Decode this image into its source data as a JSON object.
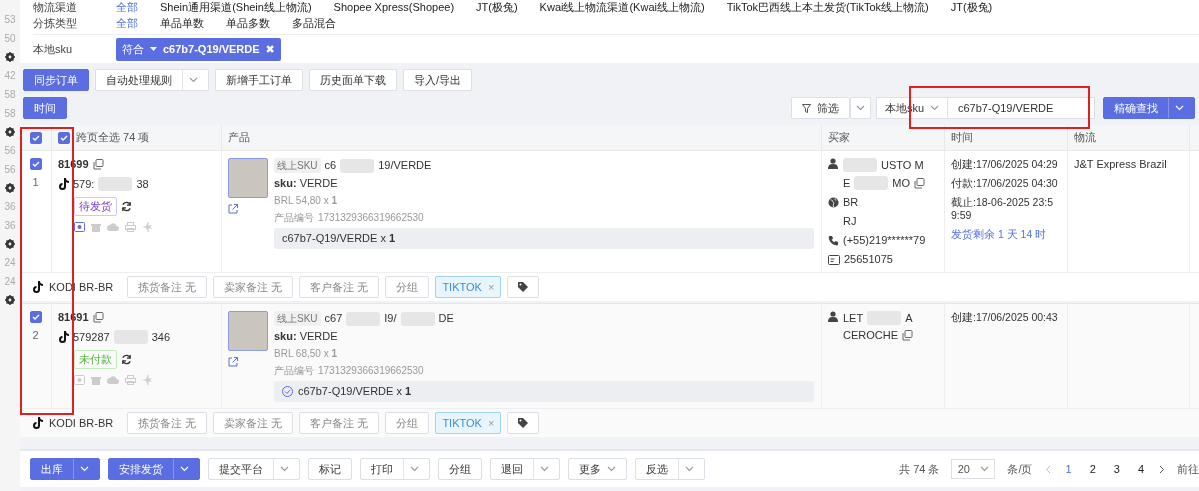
{
  "gutter": [
    {
      "kind": "number",
      "text": "53"
    },
    {
      "kind": "number",
      "text": "50"
    },
    {
      "kind": "gear"
    },
    {
      "kind": "number",
      "text": "42"
    },
    {
      "kind": "number",
      "text": "58"
    },
    {
      "kind": "number",
      "text": "58"
    },
    {
      "kind": "gear"
    },
    {
      "kind": "number",
      "text": "56"
    },
    {
      "kind": "number",
      "text": "56"
    },
    {
      "kind": "gear"
    },
    {
      "kind": "number",
      "text": "36"
    },
    {
      "kind": "number",
      "text": "36"
    },
    {
      "kind": "gear"
    },
    {
      "kind": "number",
      "text": "24"
    },
    {
      "kind": "number",
      "text": "24"
    },
    {
      "kind": "gear"
    }
  ],
  "filters": [
    {
      "label": "物流渠道",
      "options": [
        {
          "text": "全部",
          "selected": true
        },
        {
          "text": "Shein通用渠道(Shein线上物流)",
          "selected": false
        },
        {
          "text": "Shopee Xpress(Shopee)",
          "selected": false
        },
        {
          "text": "JT(极兔)",
          "selected": false
        },
        {
          "text": "Kwai线上物流渠道(Kwai线上物流)",
          "selected": false
        },
        {
          "text": "TikTok巴西线上本土发货(TikTok线上物流)",
          "selected": false
        },
        {
          "text": "JT(极兔)",
          "selected": false
        }
      ]
    },
    {
      "label": "分拣类型",
      "options": [
        {
          "text": "全部",
          "selected": true
        },
        {
          "text": "单品单数",
          "selected": false
        },
        {
          "text": "单品多数",
          "selected": false
        },
        {
          "text": "多品混合",
          "selected": false
        }
      ]
    }
  ],
  "sku_filter": {
    "label": "本地sku",
    "operator": "符合",
    "value": "c67b7-Q19/VERDE",
    "remove": "✖"
  },
  "toolbar": [
    {
      "label": "同步订单",
      "kind": "primary"
    },
    {
      "label": "自动处理规则",
      "kind": "dropdown"
    },
    {
      "label": "新增手工订单",
      "kind": "plain"
    },
    {
      "label": "历史面单下载",
      "kind": "plain"
    },
    {
      "label": "导入/导出",
      "kind": "plain"
    }
  ],
  "time_button": "时间",
  "search": {
    "filter_button": "筛选",
    "field_select": "本地sku",
    "value": "c67b7-Q19/VERDE",
    "submit": "精确查找"
  },
  "table": {
    "select_all": {
      "checked": true
    },
    "select_all_pages": {
      "checked": true,
      "label": "跨页全选 74 项"
    },
    "columns": [
      "产品",
      "买家",
      "时间",
      "物流"
    ],
    "rows": [
      {
        "checked": true,
        "index": "1",
        "order_id": "81699",
        "platform_no": [
          {
            "kind": "text",
            "text": "579:"
          },
          {
            "kind": "blur"
          },
          {
            "kind": "text",
            "text": "38"
          }
        ],
        "status": {
          "text": "待发货",
          "kind": "pending"
        },
        "product": {
          "online_sku_label": "线上SKU",
          "online_sku": [
            {
              "kind": "text",
              "text": "c6"
            },
            {
              "kind": "blur"
            },
            {
              "kind": "text",
              "text": "19/VERDE"
            }
          ],
          "sku": "**sku:** VERDE",
          "price": "BRL 54,80 x **1**",
          "code_label": "产品编号",
          "code": "1731329366319662530",
          "local_sku": "c67b7-Q19/VERDE x **1**",
          "matched": false
        },
        "buyer": {
          "name_lines": [
            [
              {
                "kind": "blur"
              },
              {
                "kind": "text",
                "text": "USTO M"
              }
            ],
            [
              {
                "kind": "text",
                "text": "E"
              },
              {
                "kind": "blur"
              },
              {
                "kind": "text",
                "text": "MO"
              },
              {
                "kind": "copy"
              }
            ]
          ],
          "details": [
            {
              "kind": "country",
              "text": "BR"
            },
            {
              "kind": "region",
              "text": "RJ"
            },
            {
              "kind": "phone",
              "text": "(+55)219******79"
            },
            {
              "kind": "id",
              "text": "25651075"
            }
          ]
        },
        "times": [
          {
            "label": "创建:",
            "value": "17/06/2025 04:29"
          },
          {
            "label": "付款:",
            "value": "17/06/2025 04:30"
          },
          {
            "label": "截止:",
            "value": "18-06-2025 23:59:59"
          }
        ],
        "remaining": "发货剩余 1 天 14 时",
        "logistics": "J&T Express Brazil",
        "footer": {
          "shop": "KODI BR-BR",
          "notes": [
            "拣货备注 无",
            "卖家备注 无",
            "客户备注 无",
            "分组"
          ],
          "tag": "TIKTOK",
          "tag_remove": "×"
        }
      },
      {
        "checked": true,
        "index": "2",
        "order_id": "81691",
        "platform_no": [
          {
            "kind": "text",
            "text": "579287"
          },
          {
            "kind": "blur"
          },
          {
            "kind": "text",
            "text": "346"
          }
        ],
        "status": {
          "text": "未付款",
          "kind": "unpaid"
        },
        "product": {
          "online_sku_label": "线上SKU",
          "online_sku": [
            {
              "kind": "text",
              "text": "c67"
            },
            {
              "kind": "blur"
            },
            {
              "kind": "text",
              "text": "I9/"
            },
            {
              "kind": "blur"
            },
            {
              "kind": "text",
              "text": "DE"
            }
          ],
          "sku": "**sku:** VERDE",
          "price": "BRL 68,50 x **1**",
          "code_label": "产品编号",
          "code": "1731329366319662530",
          "local_sku": "c67b7-Q19/VERDE x **1**",
          "matched": true
        },
        "buyer": {
          "name_lines": [
            [
              {
                "kind": "text",
                "text": "LET"
              },
              {
                "kind": "blur"
              },
              {
                "kind": "text",
                "text": "A"
              }
            ],
            [
              {
                "kind": "text",
                "text": "CEROCHE"
              },
              {
                "kind": "copy"
              }
            ]
          ]
        },
        "times": [
          {
            "label": "创建:",
            "value": "17/06/2025 00:43"
          }
        ],
        "footer": {
          "shop": "KODI BR-BR",
          "notes": [
            "拣货备注 无",
            "卖家备注 无",
            "客户备注 无",
            "分组"
          ],
          "tag": "TIKTOK",
          "tag_remove": "×"
        }
      }
    ]
  },
  "actions": [
    {
      "label": "出库",
      "kind": "primary_split"
    },
    {
      "label": "安排发货",
      "kind": "primary_split"
    },
    {
      "label": "提交平台",
      "kind": "dropdown"
    },
    {
      "label": "标记",
      "kind": "plain"
    },
    {
      "label": "打印",
      "kind": "dropdown"
    },
    {
      "label": "分组",
      "kind": "plain"
    },
    {
      "label": "退回",
      "kind": "dropdown"
    },
    {
      "label": "更多",
      "kind": "menu"
    },
    {
      "label": "反选",
      "kind": "dropdown"
    }
  ],
  "pagination": {
    "total": "共 74 条",
    "page_size": "20",
    "per_page": "条/页",
    "pages": [
      {
        "text": "1",
        "selected": true
      },
      {
        "text": "2",
        "selected": false
      },
      {
        "text": "3",
        "selected": false
      },
      {
        "text": "4",
        "selected": false
      }
    ],
    "goto": "前往"
  },
  "annotations": [
    {
      "kind": "red_box"
    },
    {
      "kind": "red_box"
    }
  ]
}
